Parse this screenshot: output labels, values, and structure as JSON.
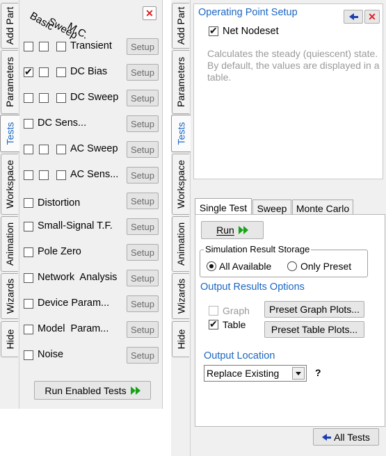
{
  "left_tabs": [
    "Add Part",
    "Parameters",
    "Tests",
    "Workspace",
    "Animation",
    "Wizards",
    "Hide"
  ],
  "left_active_tab": "Tests",
  "columns": [
    "Basic",
    "Sweep",
    "M.C."
  ],
  "close_glyph": "✕",
  "tests": [
    {
      "label": "Transient",
      "checks": [
        false,
        false,
        false
      ],
      "setup": "Setup"
    },
    {
      "label": "DC Bias",
      "checks": [
        true,
        false,
        false
      ],
      "setup": "Setup"
    },
    {
      "label": "DC Sweep",
      "checks": [
        false,
        false,
        false
      ],
      "setup": "Setup"
    },
    {
      "label": "DC Sens...",
      "checks": [
        false
      ],
      "setup": "Setup"
    },
    {
      "label": "AC Sweep",
      "checks": [
        false,
        false,
        false
      ],
      "setup": "Setup"
    },
    {
      "label": "AC Sens...",
      "checks": [
        false,
        false,
        false
      ],
      "setup": "Setup"
    },
    {
      "label": "Distortion",
      "checks": [
        false
      ],
      "setup": "Setup"
    },
    {
      "label": "Small-Signal T.F.",
      "checks": [
        false
      ],
      "setup": "Setup"
    },
    {
      "label": "Pole Zero",
      "checks": [
        false
      ],
      "setup": "Setup"
    },
    {
      "label": "Network  Analysis",
      "checks": [
        false
      ],
      "setup": "Setup"
    },
    {
      "label": "Device Param...",
      "checks": [
        false
      ],
      "setup": "Setup"
    },
    {
      "label": "Model  Param...",
      "checks": [
        false
      ],
      "setup": "Setup"
    },
    {
      "label": "Noise",
      "checks": [
        false
      ],
      "setup": "Setup"
    }
  ],
  "run_enabled_label": "Run Enabled Tests",
  "right": {
    "tabs": [
      "Add Part",
      "Parameters",
      "Tests",
      "Workspace",
      "Animation",
      "Wizards",
      "Hide"
    ],
    "title": "Operating Point Setup",
    "net_nodeset": "Net Nodeset",
    "description": "Calculates the steady (quiescent) state. By default, the values are displayed in a table.",
    "htabs": [
      "Single Test",
      "Sweep",
      "Monte Carlo"
    ],
    "run_label": "Run",
    "storage_legend": "Simulation Result Storage",
    "storage_options": [
      "All Available",
      "Only Preset"
    ],
    "output_options_heading": "Output Results Options",
    "graph_label": "Graph",
    "table_label": "Table",
    "preset_graph": "Preset Graph Plots...",
    "preset_table": "Preset Table Plots...",
    "output_location_heading": "Output Location",
    "output_location_value": "Replace Existing",
    "help_glyph": "?",
    "all_tests": "All Tests"
  },
  "colors": {
    "accent": "#1a66c2",
    "close": "#e02020",
    "run_arrow": "#16a416",
    "back_arrow": "#1a3fb0"
  }
}
